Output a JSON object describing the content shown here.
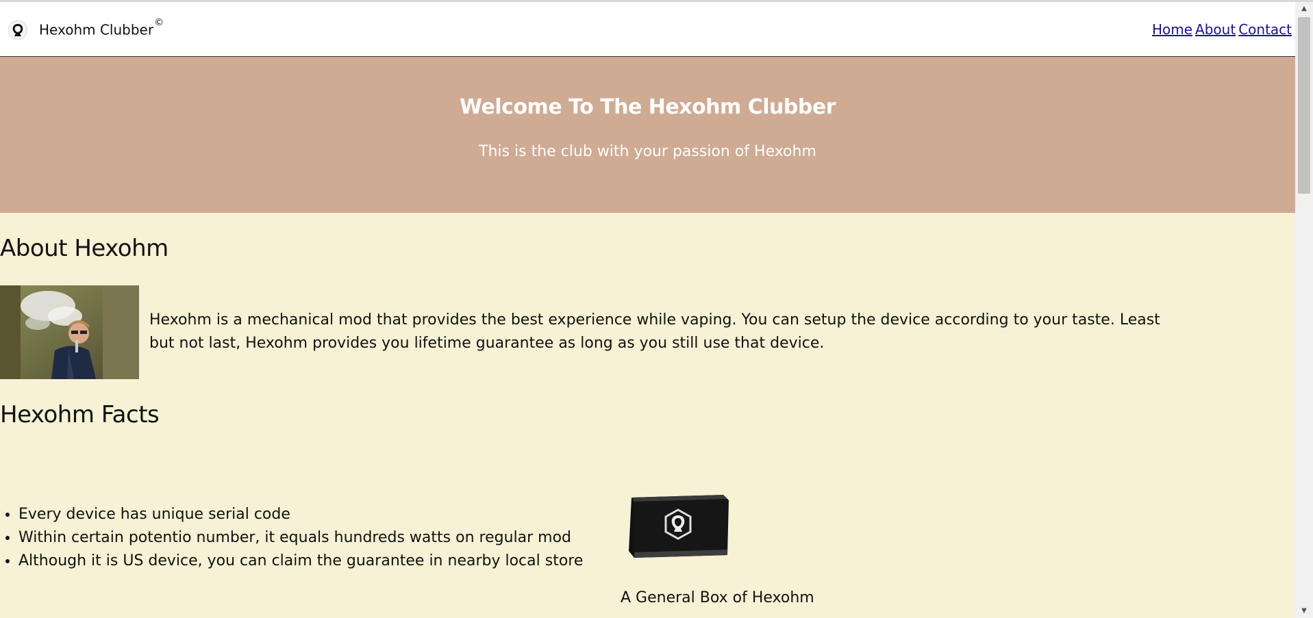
{
  "header": {
    "brand": "Hexohm Clubber",
    "brand_mark": "©",
    "logo_icon": "hexohm-logo-icon",
    "nav": [
      {
        "label": "Home"
      },
      {
        "label": "About"
      },
      {
        "label": "Contact"
      }
    ]
  },
  "hero": {
    "title": "Welcome To The Hexohm Clubber",
    "subtitle": "This is the club with your passion of Hexohm",
    "background": "#cfab93"
  },
  "about": {
    "title": "About Hexohm",
    "image": "person-vaping-photo",
    "text": "Hexohm is a mechanical mod that provides the best experience while vaping. You can setup the device according to your taste. Least but not last, Hexohm provides you lifetime guarantee as long as you still use that device."
  },
  "facts": {
    "title": "Hexohm Facts",
    "items": [
      "Every device has unique serial code",
      "Within certain potentio number, it equals hundreds watts on regular mod",
      "Although it is US device, you can claim the guarantee in nearby local store"
    ],
    "image": "hexohm-box-photo",
    "caption": "A General Box of Hexohm"
  },
  "colors": {
    "main_background": "#f7f1d5",
    "link": "#1a0dab"
  }
}
